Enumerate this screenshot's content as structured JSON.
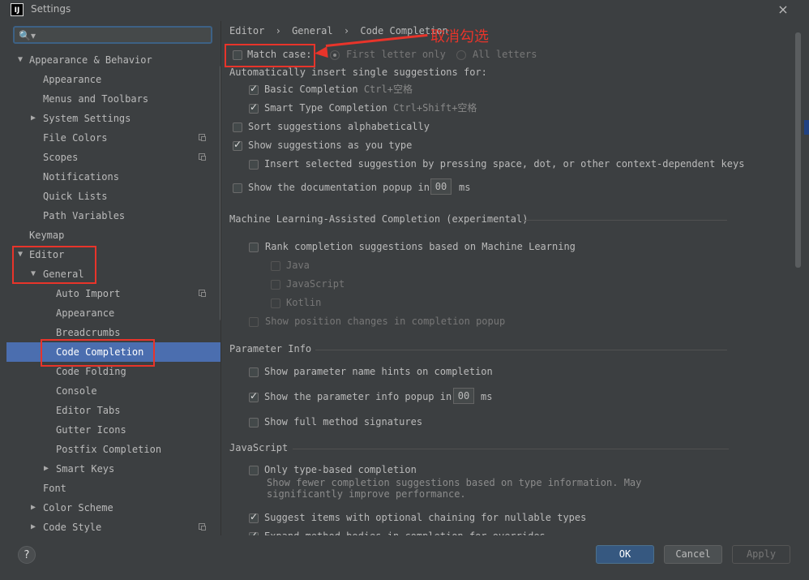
{
  "window": {
    "app_icon": "IJ",
    "title": "Settings",
    "close_icon": "×"
  },
  "search": {
    "icon": "🔍▾",
    "value": "",
    "placeholder": ""
  },
  "tree": [
    {
      "label": "Appearance & Behavior",
      "indent": 0,
      "arrow": "▼"
    },
    {
      "label": "Appearance",
      "indent": 1
    },
    {
      "label": "Menus and Toolbars",
      "indent": 1
    },
    {
      "label": "System Settings",
      "indent": 1,
      "arrow": "▶"
    },
    {
      "label": "File Colors",
      "indent": 1,
      "copy": true
    },
    {
      "label": "Scopes",
      "indent": 1,
      "copy": true
    },
    {
      "label": "Notifications",
      "indent": 1
    },
    {
      "label": "Quick Lists",
      "indent": 1
    },
    {
      "label": "Path Variables",
      "indent": 1
    },
    {
      "label": "Keymap",
      "indent": 0
    },
    {
      "label": "Editor",
      "indent": 0,
      "arrow": "▼"
    },
    {
      "label": "General",
      "indent": 1,
      "arrow": "▼"
    },
    {
      "label": "Auto Import",
      "indent": 2,
      "copy": true
    },
    {
      "label": "Appearance",
      "indent": 2
    },
    {
      "label": "Breadcrumbs",
      "indent": 2
    },
    {
      "label": "Code Completion",
      "indent": 2,
      "selected": true
    },
    {
      "label": "Code Folding",
      "indent": 2
    },
    {
      "label": "Console",
      "indent": 2
    },
    {
      "label": "Editor Tabs",
      "indent": 2
    },
    {
      "label": "Gutter Icons",
      "indent": 2
    },
    {
      "label": "Postfix Completion",
      "indent": 2
    },
    {
      "label": "Smart Keys",
      "indent": 2,
      "arrow": "▶"
    },
    {
      "label": "Font",
      "indent": 1
    },
    {
      "label": "Color Scheme",
      "indent": 1,
      "arrow": "▶"
    },
    {
      "label": "Code Style",
      "indent": 1,
      "arrow": "▶",
      "copy": true
    }
  ],
  "breadcrumb": {
    "items": [
      "Editor",
      "General",
      "Code Completion"
    ],
    "separator": "›"
  },
  "annotation": {
    "text": "取消勾选"
  },
  "completion": {
    "match_case": "Match case:",
    "first_letter": "First letter only",
    "all_letters": "All letters",
    "auto_insert": "Automatically insert single suggestions for:",
    "basic": "Basic Completion",
    "basic_shortcut": "Ctrl+空格",
    "smart": "Smart Type Completion",
    "smart_shortcut": "Ctrl+Shift+空格",
    "sort_alpha": "Sort suggestions alphabetically",
    "show_as_type": "Show suggestions as you type",
    "insert_selected": "Insert selected suggestion by pressing space, dot, or other context-dependent keys",
    "doc_popup_prefix": "Show the documentation popup in",
    "doc_popup_value": "00",
    "doc_popup_unit": "ms"
  },
  "ml": {
    "title": "Machine Learning-Assisted Completion (experimental)",
    "rank": "Rank completion suggestions based on Machine Learning",
    "java": "Java",
    "javascript": "JavaScript",
    "kotlin": "Kotlin",
    "show_position": "Show position changes in completion popup"
  },
  "param_info": {
    "title": "Parameter Info",
    "show_hints": "Show parameter name hints on completion",
    "show_popup_prefix": "Show the parameter info popup in",
    "show_popup_value": "00",
    "show_popup_unit": "ms",
    "full_signatures": "Show full method signatures"
  },
  "javascript": {
    "title": "JavaScript",
    "only_type_based": "Only type-based completion",
    "desc_line1": "Show fewer completion suggestions based on type information. May",
    "desc_line2": "significantly improve performance.",
    "suggest_optional": "Suggest items with optional chaining for nullable types",
    "expand_method": "Expand method bodies in completion for overrides"
  },
  "buttons": {
    "help": "?",
    "ok": "OK",
    "cancel": "Cancel",
    "apply": "Apply"
  },
  "colors": {
    "selection": "#4b6eaf",
    "annotation_red": "#e8342a",
    "ok_blue": "#365880"
  }
}
